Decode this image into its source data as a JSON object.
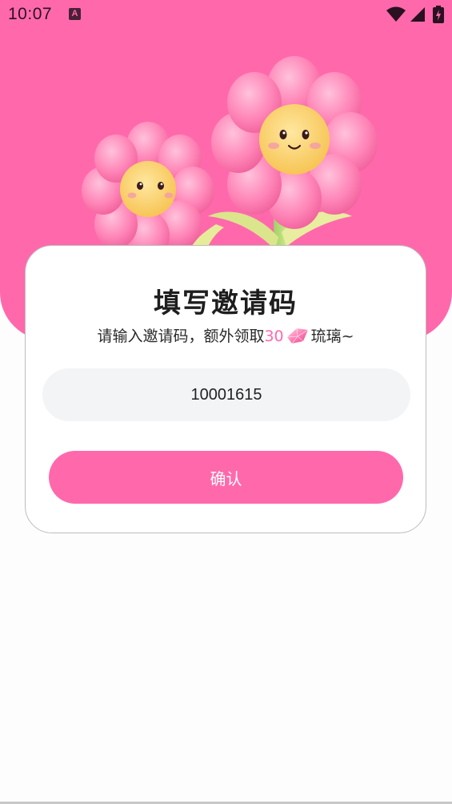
{
  "status_bar": {
    "time": "10:07",
    "notification_icon": "A",
    "icons": [
      "wifi-icon",
      "signal-icon",
      "battery-charging-icon"
    ]
  },
  "colors": {
    "accent": "#ff69ac",
    "input_background": "#f3f4f6",
    "title_text": "#1e1e1e"
  },
  "hero": {
    "illustration": "smiling-flowers-illustration"
  },
  "invite": {
    "title": "填写邀请码",
    "subtitle_prefix": "请输入邀请码，额外领取",
    "reward_amount": "30",
    "reward_icon": "gem-icon",
    "subtitle_suffix": "琉璃~",
    "code_value": "10001615",
    "confirm_label": "确认"
  }
}
